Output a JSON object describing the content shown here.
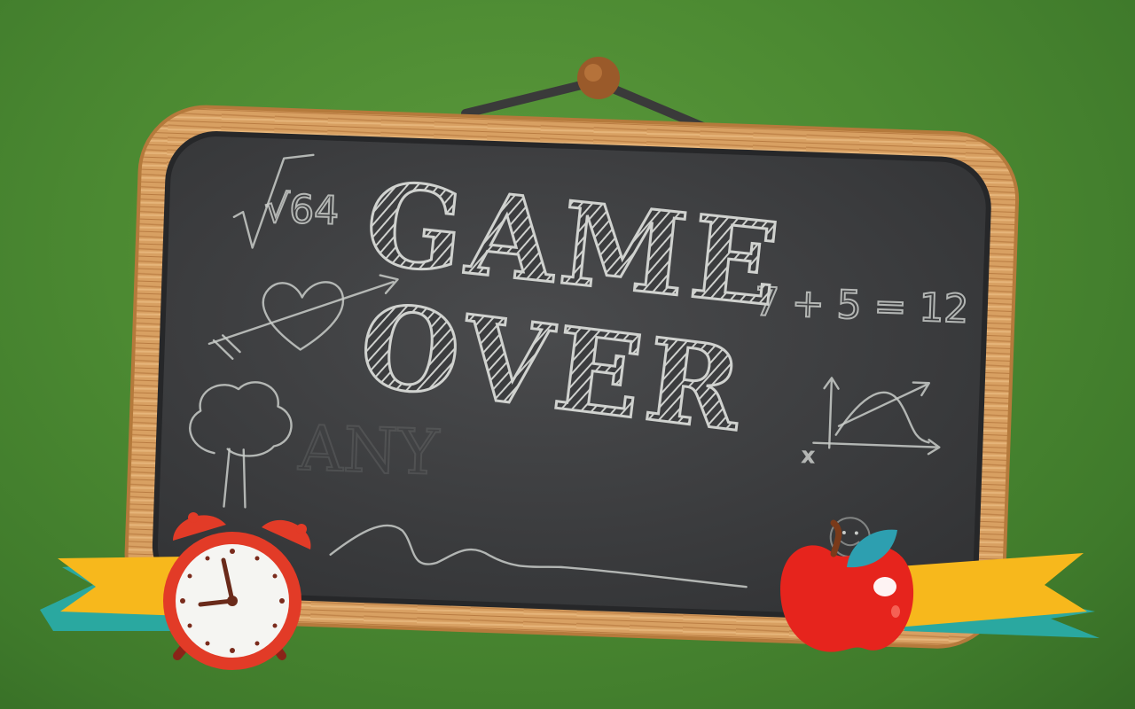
{
  "screen": {
    "title_line1": "GAME",
    "title_line2": "OVER"
  },
  "doodles": {
    "root_expr": "√64",
    "equation": "7 + 5 = 12",
    "cross_mark": "x"
  },
  "colors": {
    "background": "#4c8a32",
    "board_frame": "#d49a5a",
    "board_surface": "#3c3d3f",
    "chalk": "#c9ccc9",
    "ribbon": "#f7b81c",
    "ribbon_shadow": "#2aa8a0",
    "clock_red": "#e23b27",
    "apple_red": "#e6241d",
    "apple_leaf": "#2d9fb0"
  },
  "icons": [
    "alarm-clock-icon",
    "apple-icon",
    "heart-doodle",
    "tree-doodle",
    "graph-doodle"
  ]
}
